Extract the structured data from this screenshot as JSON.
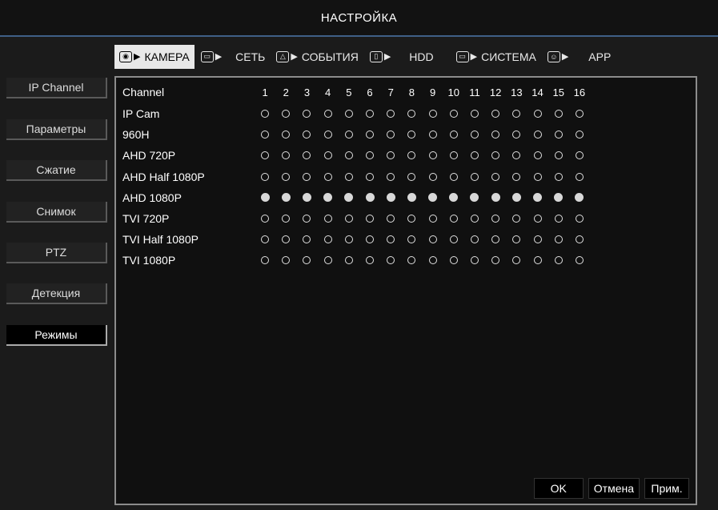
{
  "title": "НАСТРОЙКА",
  "tabs": [
    {
      "label": "КАМЕРА",
      "icon": "camera-icon",
      "active": true
    },
    {
      "label": "СЕТЬ",
      "icon": "network-icon",
      "active": false
    },
    {
      "label": "СОБЫТИЯ",
      "icon": "alarm-icon",
      "active": false
    },
    {
      "label": "HDD",
      "icon": "disk-icon",
      "active": false
    },
    {
      "label": "СИСТЕМА",
      "icon": "monitor-icon",
      "active": false
    },
    {
      "label": "APP",
      "icon": "app-icon",
      "active": false
    }
  ],
  "sidebar": {
    "items": [
      {
        "label": "IP Channel",
        "active": false
      },
      {
        "label": "Параметры",
        "active": false
      },
      {
        "label": "Сжатие",
        "active": false
      },
      {
        "label": "Снимок",
        "active": false
      },
      {
        "label": "PTZ",
        "active": false
      },
      {
        "label": "Детекция",
        "active": false
      },
      {
        "label": "Режимы",
        "active": true
      }
    ]
  },
  "grid": {
    "header_label": "Channel",
    "channels": [
      "1",
      "2",
      "3",
      "4",
      "5",
      "6",
      "7",
      "8",
      "9",
      "10",
      "11",
      "12",
      "13",
      "14",
      "15",
      "16"
    ],
    "rows": [
      {
        "label": "IP Cam",
        "selected": false
      },
      {
        "label": "960H",
        "selected": false
      },
      {
        "label": "AHD 720P",
        "selected": false
      },
      {
        "label": "AHD Half 1080P",
        "selected": false
      },
      {
        "label": "AHD 1080P",
        "selected": true
      },
      {
        "label": "TVI 720P",
        "selected": false
      },
      {
        "label": "TVI Half 1080P",
        "selected": false
      },
      {
        "label": "TVI 1080P",
        "selected": false
      }
    ]
  },
  "buttons": {
    "ok": "OK",
    "cancel": "Отмена",
    "apply": "Прим."
  }
}
